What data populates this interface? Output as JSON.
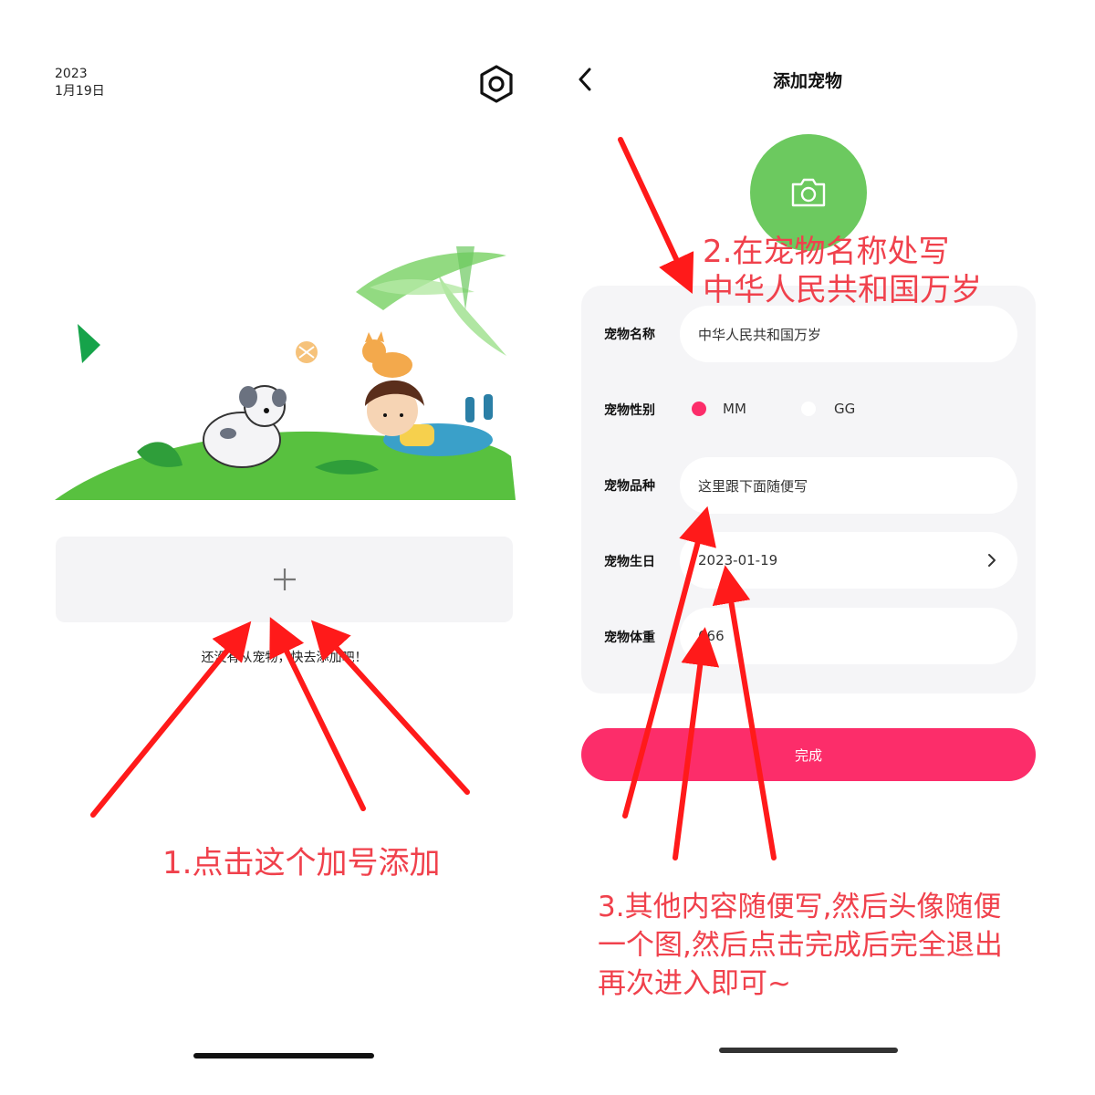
{
  "left_screen": {
    "date_year": "2023",
    "date_day": "1月19日",
    "settings_icon": "hexagon-settings-icon",
    "add_icon": "plus-icon",
    "empty_hint": "还没有从宠物，快去添加吧！"
  },
  "right_screen": {
    "title": "添加宠物",
    "back_icon": "chevron-left-icon",
    "avatar_icon": "camera-icon",
    "form": {
      "name_label": "宠物名称",
      "name_value": "中华人民共和国万岁",
      "gender_label": "宠物性别",
      "gender_options": [
        "MM",
        "GG"
      ],
      "gender_selected": "MM",
      "breed_label": "宠物品种",
      "breed_value": "这里跟下面随便写",
      "birthday_label": "宠物生日",
      "birthday_value": "2023-01-19",
      "weight_label": "宠物体重",
      "weight_value": "666"
    },
    "submit_label": "完成"
  },
  "annotations": {
    "step1": "1.点击这个加号添加",
    "step2_line1": "2.在宠物名称处写",
    "step2_line2": "中华人民共和国万岁",
    "step3_line1": "3.其他内容随便写,然后头像随便",
    "step3_line2": "一个图,然后点击完成后完全退出",
    "step3_line3": "再次进入即可~"
  },
  "colors": {
    "accent": "#fc2d6a",
    "avatar": "#6cc95f",
    "annotation": "#f0414c",
    "arrow": "#ff1a1a",
    "card": "#f5f5f7"
  }
}
